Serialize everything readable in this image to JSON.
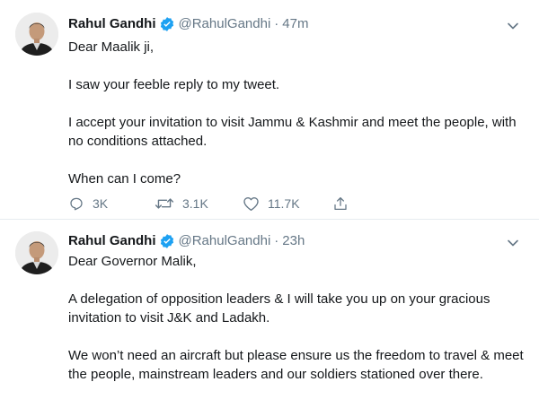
{
  "colors": {
    "text": "#14171a",
    "secondary": "#657786",
    "verified": "#1da1f2",
    "divider": "#e6ecf0"
  },
  "tweets": [
    {
      "name": "Rahul Gandhi",
      "handle": "@RahulGandhi",
      "separator": "·",
      "time": "47m",
      "verified": true,
      "paragraphs": [
        "Dear Maalik ji,",
        "I saw your feeble reply to my tweet.",
        "I accept your invitation to visit Jammu & Kashmir and meet the people, with no conditions attached.",
        "When can I come?"
      ],
      "actions": {
        "reply_count": "3K",
        "retweet_count": "3.1K",
        "like_count": "11.7K"
      },
      "icons": [
        "reply-icon",
        "retweet-icon",
        "like-icon",
        "share-icon",
        "chevron-down-icon",
        "verified-badge-icon"
      ]
    },
    {
      "name": "Rahul Gandhi",
      "handle": "@RahulGandhi",
      "separator": "·",
      "time": "23h",
      "verified": true,
      "paragraphs": [
        "Dear Governor Malik,",
        "A delegation of opposition leaders & I will take you up on your gracious invitation to visit J&K and Ladakh.",
        "We won’t need an aircraft but please ensure us the freedom to travel & meet the people, mainstream leaders and our soldiers stationed over there."
      ],
      "icons": [
        "chevron-down-icon",
        "verified-badge-icon"
      ]
    }
  ]
}
